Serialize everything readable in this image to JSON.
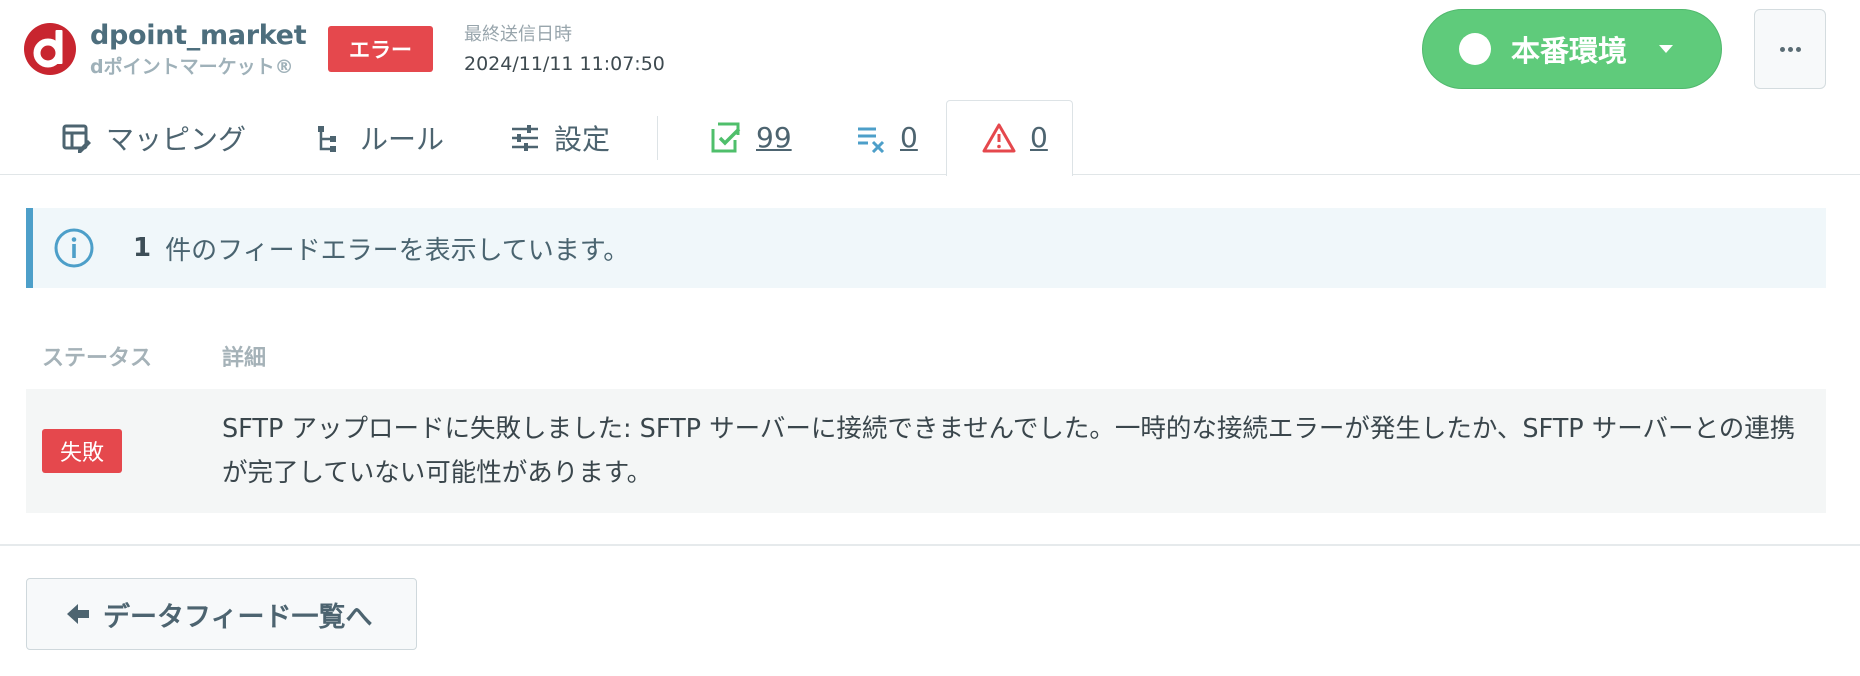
{
  "header": {
    "brand_name": "dpoint_market",
    "brand_subtitle": "dポイントマーケット®",
    "error_badge": "エラー",
    "last_sent_label": "最終送信日時",
    "last_sent_value": "2024/11/11 11:07:50",
    "environment_label": "本番環境"
  },
  "tabs": {
    "mapping": "マッピング",
    "rules": "ルール",
    "settings": "設定",
    "success_count": "99",
    "excluded_count": "0",
    "error_count": "0"
  },
  "alert": {
    "count": "1",
    "message": "件のフィードエラーを表示しています。"
  },
  "table": {
    "headers": [
      "ステータス",
      "詳細"
    ],
    "rows": [
      {
        "status": "失敗",
        "detail": "SFTP アップロードに失敗しました: SFTP サーバーに接続できませんでした。一時的な接続エラーが発生したか、SFTP サーバーとの連携が完了していない可能性があります。"
      }
    ]
  },
  "back_button": "データフィード一覧へ",
  "colors": {
    "error": "#e5484d",
    "environment": "#5fcb7b",
    "info_accent": "#4d9fc9",
    "brand_logo": "#c8252f"
  },
  "icons": {
    "mapping": "table-edit-icon",
    "rules": "tree-list-icon",
    "settings": "sliders-icon",
    "success": "checklist-icon",
    "excluded": "list-remove-icon",
    "error": "warning-triangle-icon",
    "info": "info-circle-icon",
    "back": "arrow-left-icon"
  }
}
